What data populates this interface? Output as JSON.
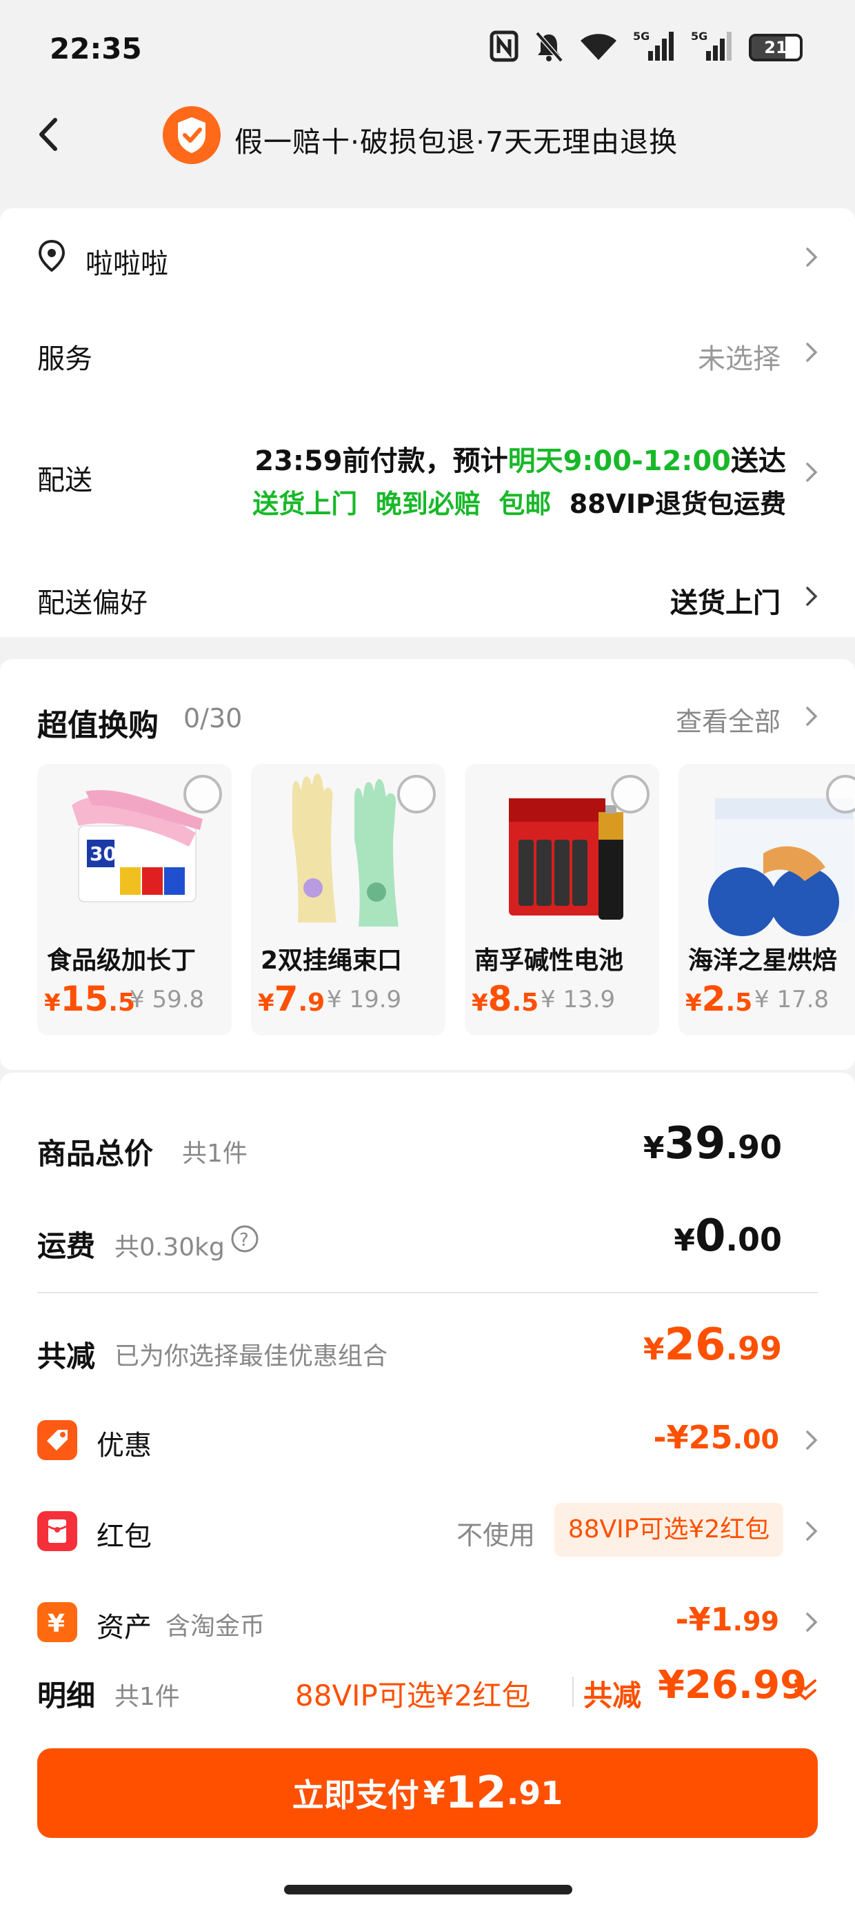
{
  "status_bar": {
    "time": "22:35",
    "battery": "21",
    "signal_label": "5G"
  },
  "header": {
    "title": "假一赔十·破损包退·7天无理由退换"
  },
  "address": {
    "text": "啦啦啦"
  },
  "service": {
    "label": "服务",
    "value": "未选择"
  },
  "delivery": {
    "label": "配送",
    "line1_prefix": "23:59前付款，预计",
    "line1_time": "明天9:00-12:00",
    "line1_suffix": "送达",
    "tags": [
      "送货上门",
      "晚到必赔",
      "包邮"
    ],
    "vip_note": "88VIP退货包运费"
  },
  "delivery_pref": {
    "label": "配送偏好",
    "value": "送货上门"
  },
  "swap": {
    "title": "超值换购",
    "count": "0/30",
    "view_all": "查看全部",
    "products": [
      {
        "name": "食品级加长丁",
        "yen": "¥",
        "price_int": "15",
        "price_dec": ".5",
        "orig": "¥ 59.8"
      },
      {
        "name": "2双挂绳束口",
        "yen": "¥",
        "price_int": "7",
        "price_dec": ".9",
        "orig": "¥ 19.9"
      },
      {
        "name": "南孚碱性电池",
        "yen": "¥",
        "price_int": "8",
        "price_dec": ".5",
        "orig": "¥ 13.9"
      },
      {
        "name": "海洋之星烘焙",
        "yen": "¥",
        "price_int": "2",
        "price_dec": ".5",
        "orig": "¥ 17.8"
      }
    ]
  },
  "summary": {
    "total_label": "商品总价",
    "total_count": "共1件",
    "total_yen": "¥",
    "total_int": "39",
    "total_dec": ".90",
    "shipping_label": "运费",
    "shipping_weight": "共0.30kg",
    "shipping_yen": "¥",
    "shipping_int": "0",
    "shipping_dec": ".00",
    "reduce_label": "共减",
    "reduce_note": "已为你选择最佳优惠组合",
    "reduce_yen": "¥",
    "reduce_int": "26",
    "reduce_dec": ".99",
    "discount_label": "优惠",
    "discount_int": "-¥25",
    "discount_dec": ".00",
    "redpacket_label": "红包",
    "redpacket_none": "不使用",
    "redpacket_tag": "88VIP可选¥2红包",
    "asset_label": "资产",
    "asset_note": "含淘金币",
    "asset_int": "-¥1",
    "asset_dec": ".99"
  },
  "detail": {
    "label": "明细",
    "count": "共1件",
    "redpacket": "88VIP可选¥2红包",
    "total_label": "共减",
    "total": "¥26.99"
  },
  "pay": {
    "label": "立即支付",
    "yen": "¥",
    "int": "12",
    "dec": ".91"
  },
  "colors": {
    "accent": "#ff5000",
    "green": "#18b829"
  }
}
